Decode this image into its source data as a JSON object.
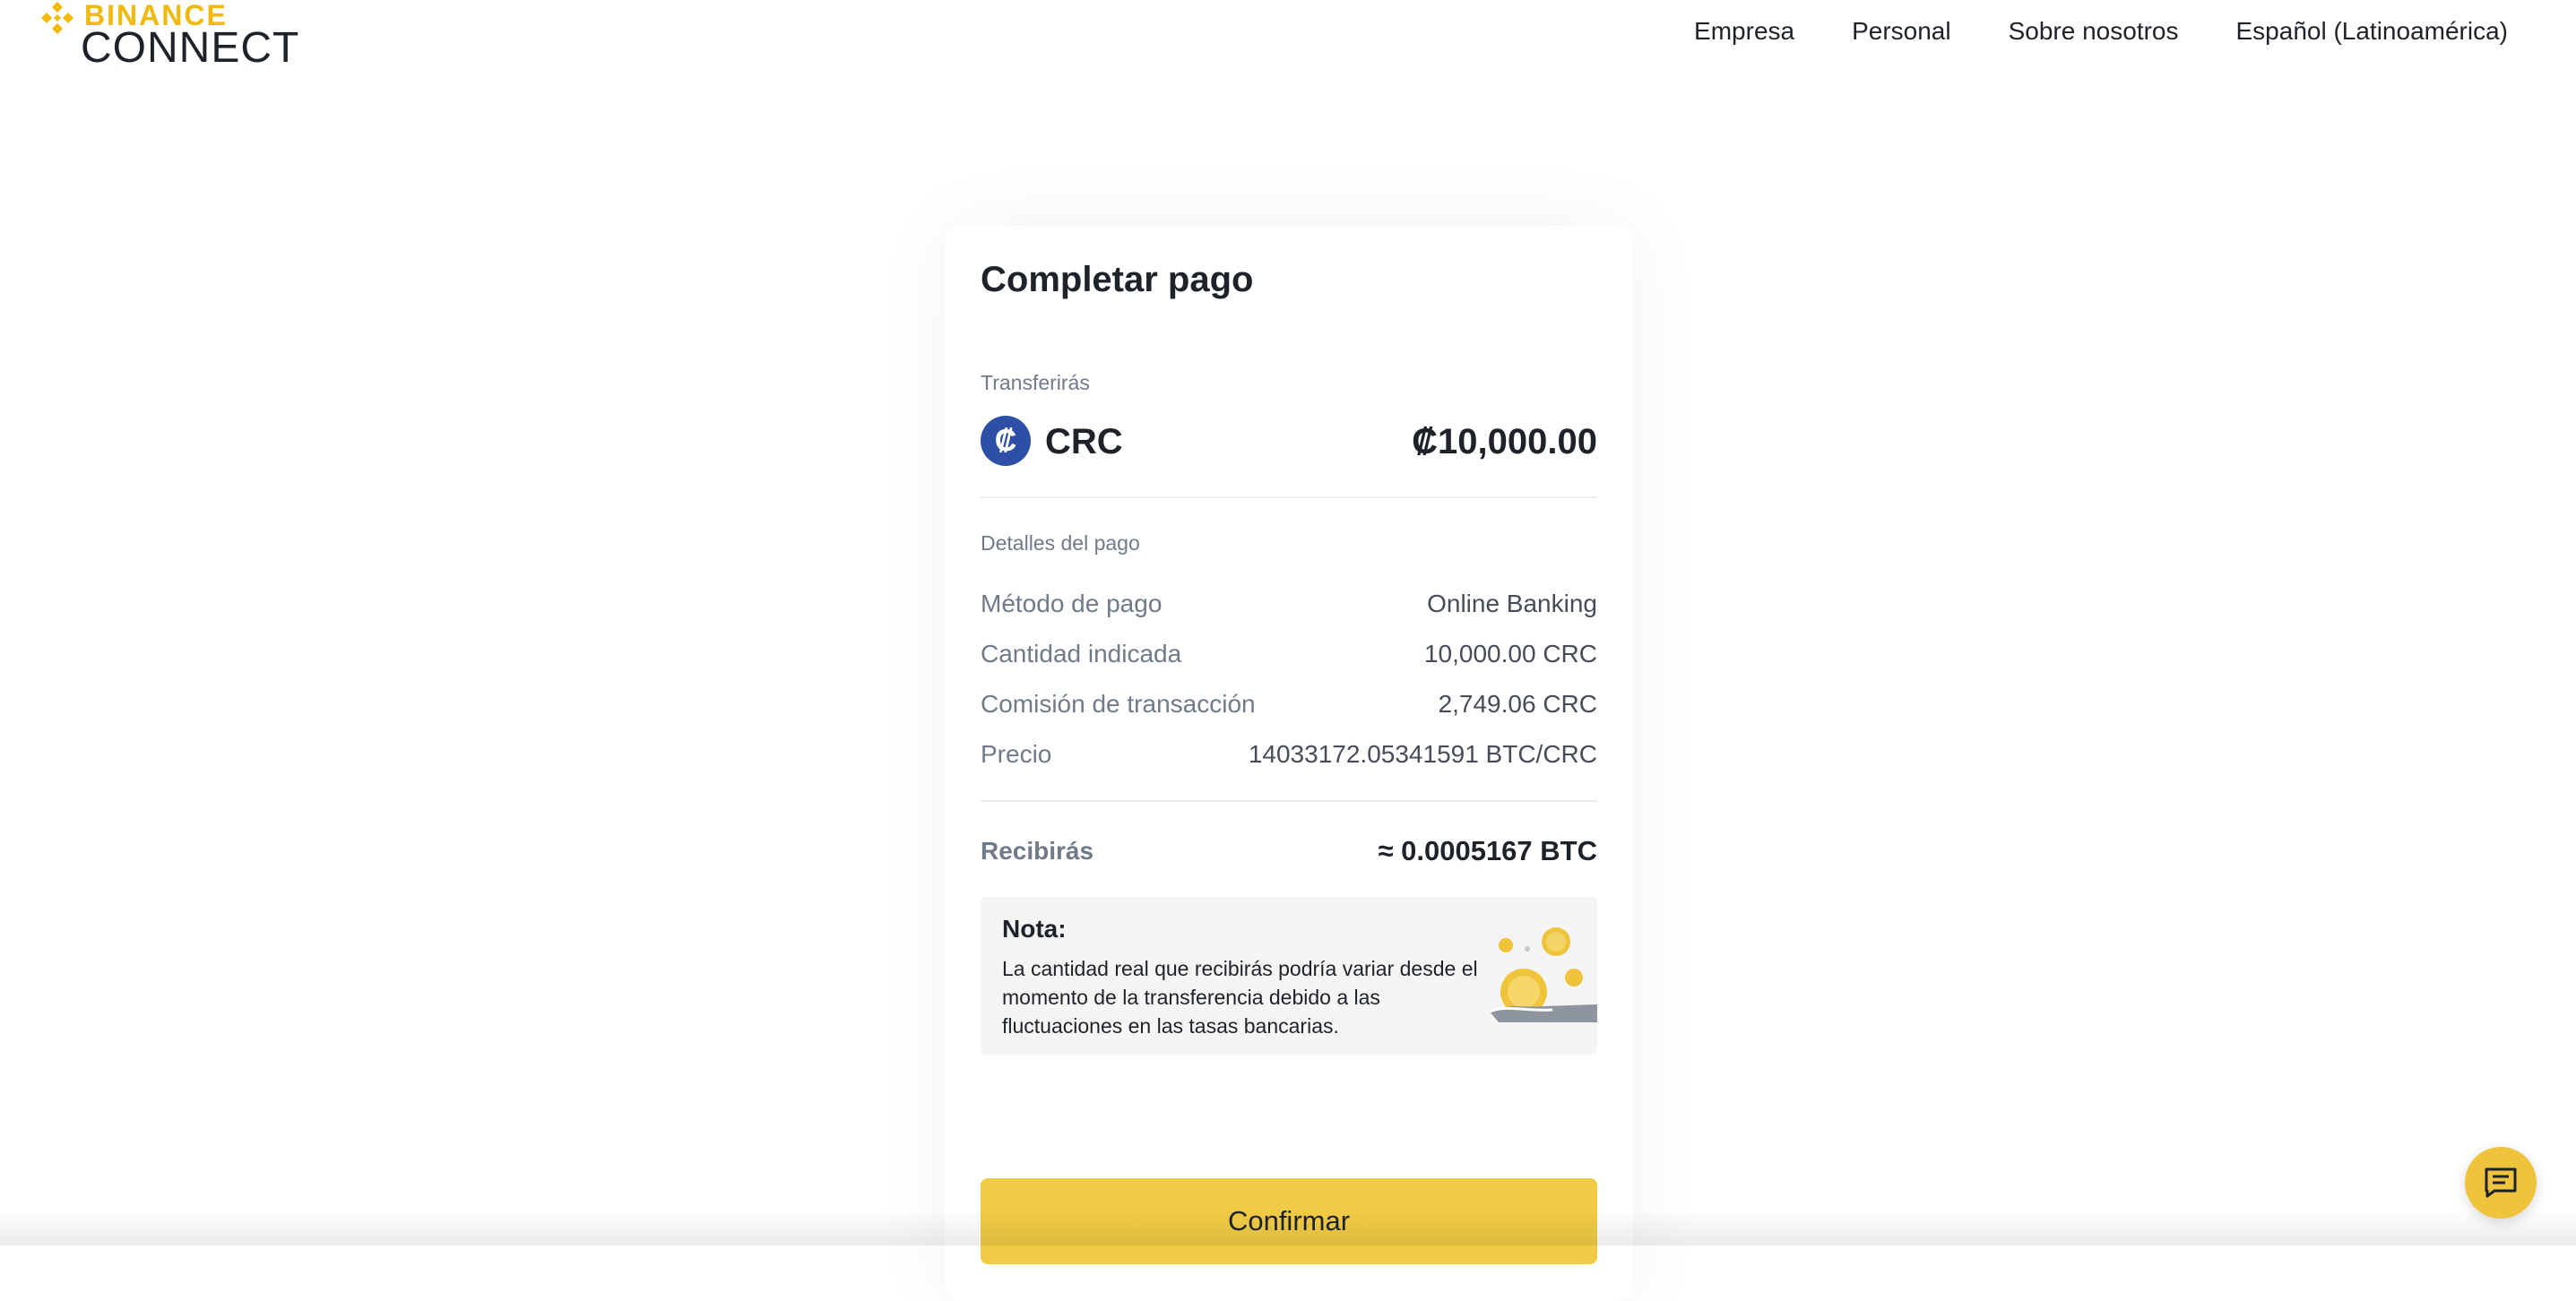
{
  "header": {
    "logo_top": "BINANCE",
    "logo_bottom": "CONNECT",
    "nav": [
      "Empresa",
      "Personal",
      "Sobre nosotros",
      "Español (Latinoamérica)"
    ]
  },
  "card": {
    "title": "Completar pago",
    "transfer_label": "Transferirás",
    "currency_symbol": "₡",
    "currency_code": "CRC",
    "amount": "₡10,000.00",
    "details_label": "Detalles del pago",
    "details": [
      {
        "key": "Método de pago",
        "value": "Online Banking"
      },
      {
        "key": "Cantidad indicada",
        "value": "10,000.00 CRC"
      },
      {
        "key": "Comisión de transacción",
        "value": "2,749.06 CRC"
      },
      {
        "key": "Precio",
        "value": "14033172.05341591 BTC/CRC"
      }
    ],
    "receive_label": "Recibirás",
    "receive_value": "≈ 0.0005167 BTC",
    "note_title": "Nota:",
    "note_text": "La cantidad real que recibirás podría variar desde el momento de la transferencia debido a las fluctuaciones en las tasas bancarias.",
    "confirm_label": "Confirmar"
  },
  "colors": {
    "brand": "#f0b90b",
    "button": "#f0cb45",
    "currency_icon": "#2e4fa6"
  },
  "icons": {
    "logo": "binance-diamond-icon",
    "chat": "chat-icon",
    "note_illustration": "coins-hand-icon"
  }
}
